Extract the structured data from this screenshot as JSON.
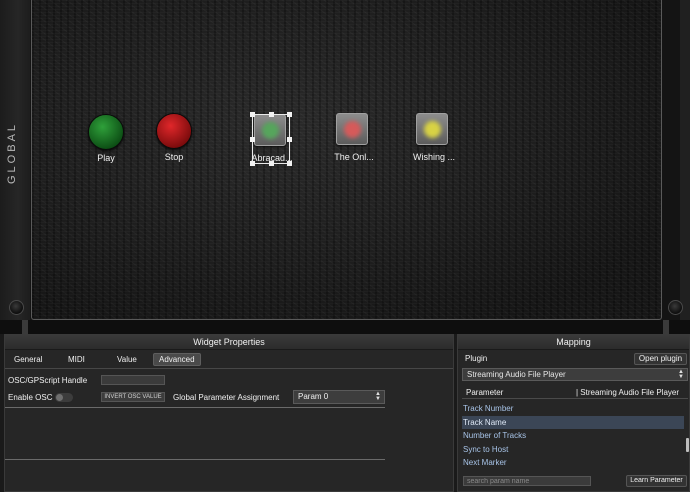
{
  "rackspace": {
    "panel_label": "GLOBAL",
    "widgets": [
      {
        "label": "Play",
        "kind": "round",
        "color": "#1f8a2a"
      },
      {
        "label": "Stop",
        "kind": "round",
        "color": "#c41416"
      },
      {
        "label": "Abracad...",
        "kind": "square",
        "led_color": "#4caf50",
        "selected": true
      },
      {
        "label": "The Onl...",
        "kind": "square",
        "led_color": "#e04848"
      },
      {
        "label": "Wishing ...",
        "kind": "square",
        "led_color": "#e6e040"
      }
    ]
  },
  "widget_properties": {
    "title": "Widget Properties",
    "tabs": [
      "General",
      "MIDI",
      "Value",
      "Advanced"
    ],
    "active_tab": "Advanced",
    "osc_handle_label": "OSC/GPScript Handle",
    "osc_handle_value": "",
    "enable_osc_label": "Enable OSC",
    "enable_osc": false,
    "invert_osc_label": "INVERT OSC VALUE",
    "global_param_label": "Global Parameter Assignment",
    "global_param_value": "Param 0"
  },
  "mapping": {
    "title": "Mapping",
    "plugin_label": "Plugin",
    "open_plugin_label": "Open plugin",
    "plugin_value": "Streaming Audio File Player",
    "parameter_header": "Parameter",
    "parameter_plugin_header": "| Streaming Audio File Player",
    "parameters": [
      "Track Number",
      "Track Name",
      "Number of Tracks",
      "Sync to Host",
      "Next Marker"
    ],
    "selected_parameter": "Track Name",
    "search_placeholder": "search param name",
    "learn_parameter_label": "Learn Parameter"
  }
}
